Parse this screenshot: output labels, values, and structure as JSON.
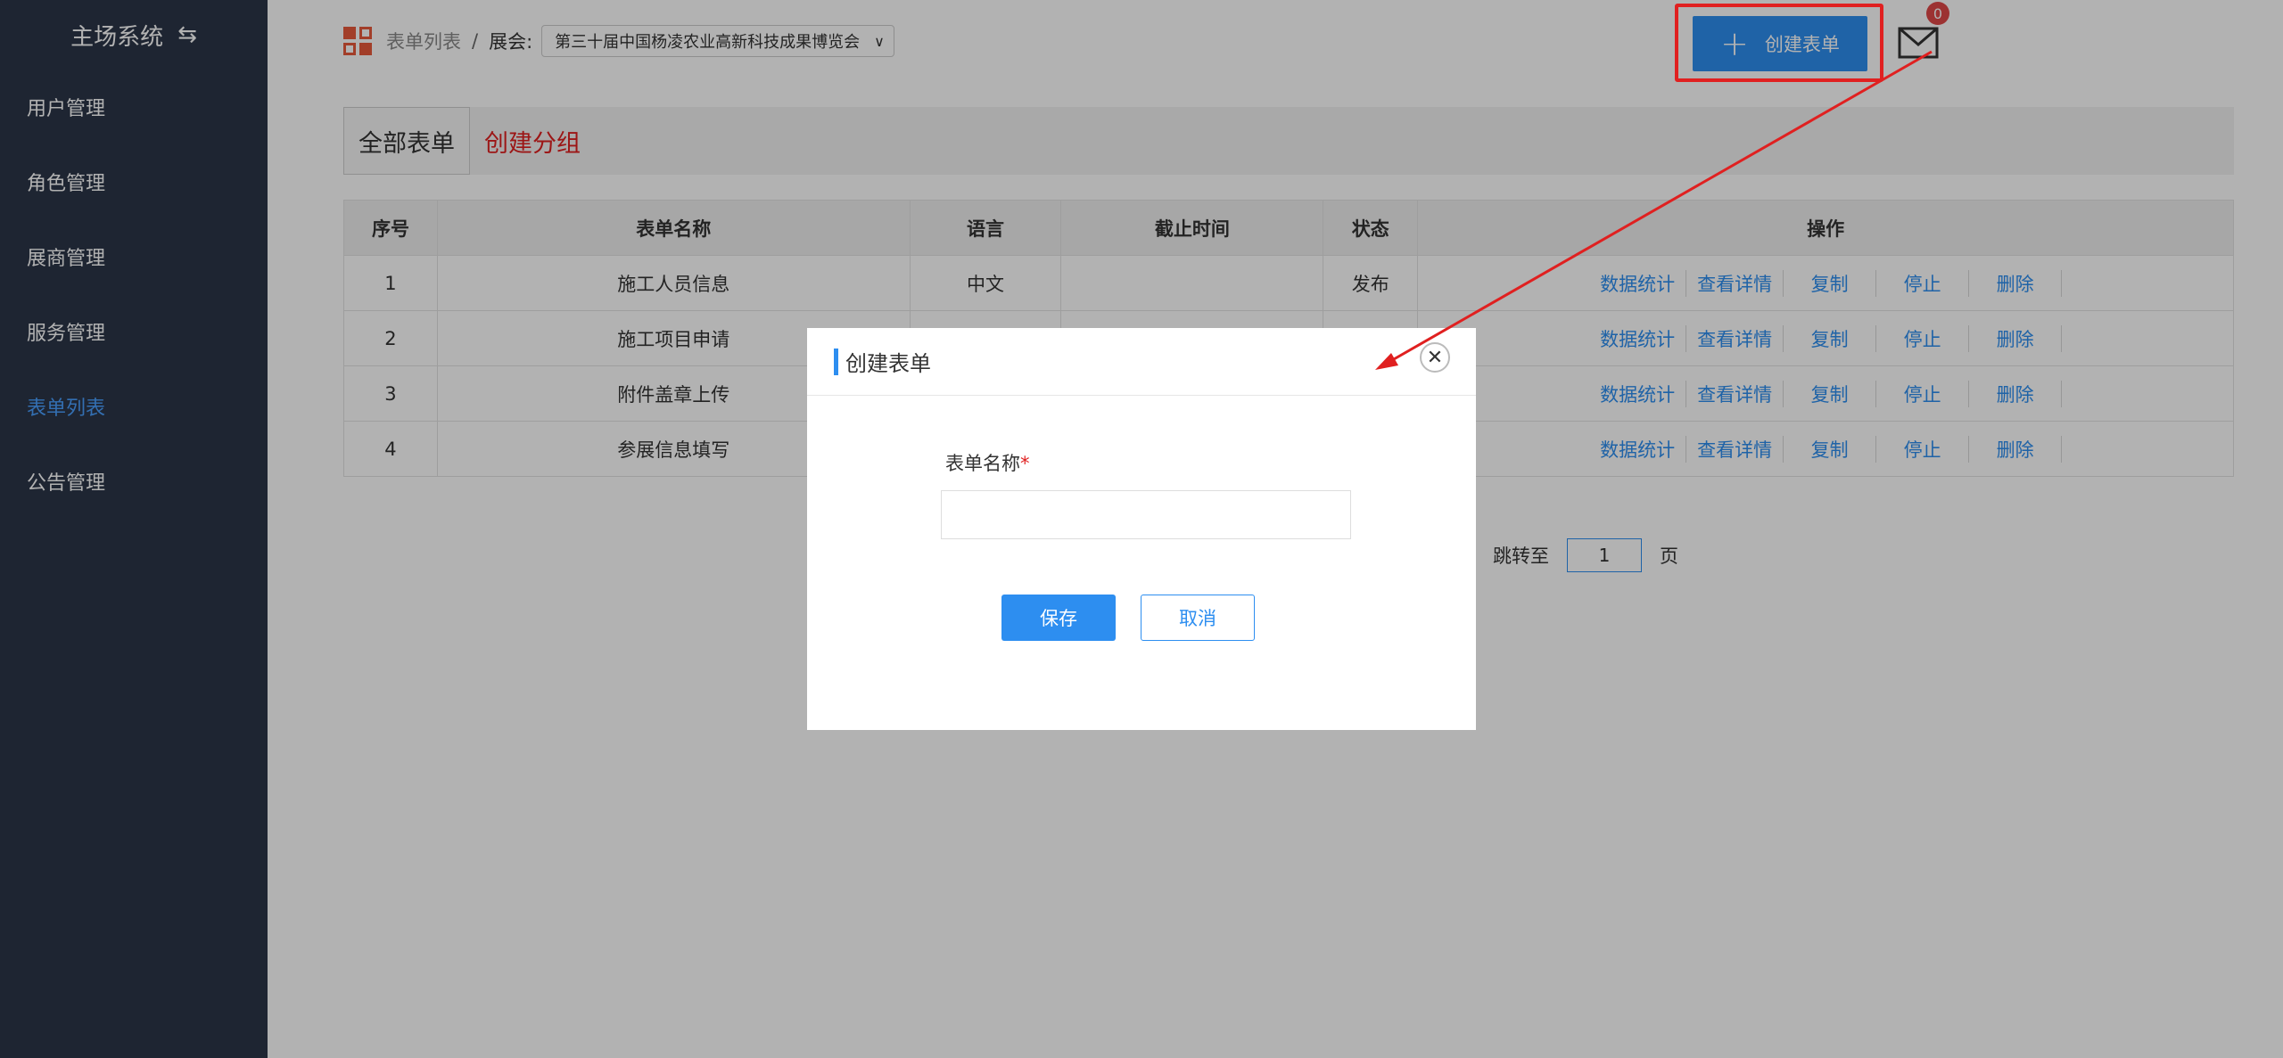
{
  "sidebar": {
    "title": "主场系统",
    "swap_icon": "swap-icon",
    "items": [
      {
        "label": "用户管理"
      },
      {
        "label": "角色管理"
      },
      {
        "label": "展商管理"
      },
      {
        "label": "服务管理"
      },
      {
        "label": "表单列表",
        "active": true
      },
      {
        "label": "公告管理"
      }
    ]
  },
  "breadcrumb": {
    "link": "表单列表",
    "separator": "/",
    "expo_label": "展会:",
    "expo_value": "第三十届中国杨凌农业高新科技成果博览会"
  },
  "header": {
    "create_label": "创建表单",
    "mail_count": "0"
  },
  "tabs": {
    "all": "全部表单",
    "create_group": "创建分组"
  },
  "table": {
    "headers": [
      "序号",
      "表单名称",
      "语言",
      "截止时间",
      "状态",
      "操作"
    ],
    "rows": [
      {
        "no": "1",
        "name": "施工人员信息",
        "lang": "中文",
        "deadline": "",
        "status": "发布"
      },
      {
        "no": "2",
        "name": "施工项目申请",
        "lang": "",
        "deadline": "",
        "status": ""
      },
      {
        "no": "3",
        "name": "附件盖章上传",
        "lang": "",
        "deadline": "",
        "status": ""
      },
      {
        "no": "4",
        "name": "参展信息填写",
        "lang": "",
        "deadline": "",
        "status": ""
      }
    ],
    "actions": {
      "stats": "数据统计",
      "detail": "查看详情",
      "copy": "复制",
      "stop": "停止",
      "delete": "删除"
    }
  },
  "pagination": {
    "jump_label": "跳转至",
    "page_value": "1",
    "page_unit": "页"
  },
  "modal": {
    "title": "创建表单",
    "field_label": "表单名称",
    "required_mark": "*",
    "field_value": "",
    "save": "保存",
    "cancel": "取消",
    "close_glyph": "✕"
  },
  "colors": {
    "sidebar_bg": "#2b3548",
    "accent": "#2d8ef0",
    "annotation": "#e02020"
  }
}
